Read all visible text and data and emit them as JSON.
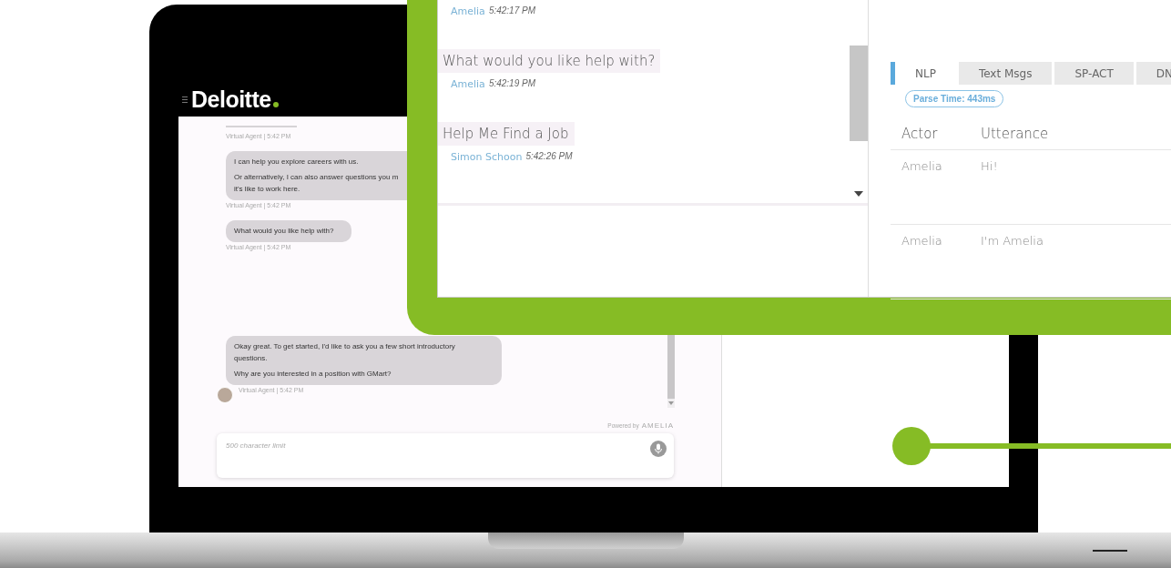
{
  "app_header": {
    "logo": "Deloitte"
  },
  "chat": {
    "top_meta": "Virtual Agent | 5:42 PM",
    "messages": [
      {
        "paragraphs": [
          [
            "I can help you explore careers with us."
          ],
          [
            "Or alternatively, I can also answer questions you m",
            "it's like to work here."
          ]
        ],
        "meta": "Virtual Agent | 5:42 PM",
        "avatar": false
      },
      {
        "paragraphs": [
          [
            "What would you like help with?"
          ]
        ],
        "meta": "Virtual Agent | 5:42 PM",
        "avatar": false
      },
      {
        "paragraphs": [
          [
            "Okay great. To get started, I'd like to ask you a few short introductory",
            "questions."
          ],
          [
            "Why are you interested in a position with GMart?"
          ]
        ],
        "meta": "Virtual Agent | 5:42 PM",
        "avatar": true
      }
    ],
    "powered_by": "Powered by",
    "brand": "AMELIA",
    "input": {
      "placeholder": "500 character limit"
    }
  },
  "overlay": {
    "transcript": [
      {
        "author": "Amelia",
        "time": "5:42:17 PM"
      },
      {
        "text": "What would you like help with?",
        "author": "Amelia",
        "time": "5:42:19 PM"
      },
      {
        "text": "Help Me Find a Job",
        "author": "Simon Schoon",
        "time": "5:42:26 PM"
      }
    ],
    "tabs": [
      {
        "label": "NLP",
        "selected": true
      },
      {
        "label": "Text Msgs",
        "selected": false
      },
      {
        "label": "SP-ACT",
        "selected": false
      },
      {
        "label": "DN",
        "selected": false
      }
    ],
    "parse_time": "Parse Time: 443ms",
    "table": {
      "columns": [
        "Actor",
        "Utterance"
      ],
      "rows": [
        [
          "Amelia",
          "Hi!"
        ],
        [
          "Amelia",
          "I'm Amelia"
        ]
      ]
    }
  }
}
